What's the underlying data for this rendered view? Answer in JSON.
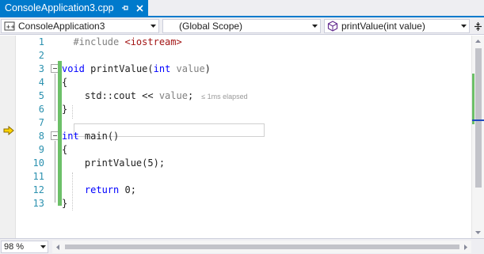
{
  "tab": {
    "title": "ConsoleApplication3.cpp",
    "pin_icon": "pin-icon",
    "close_icon": "close-icon"
  },
  "navbar": {
    "project": "ConsoleApplication3",
    "scope": "(Global Scope)",
    "member": "printValue(int value)",
    "project_icon": "cpp-project-icon",
    "member_icon": "function-icon",
    "split_icon": "split-window-icon"
  },
  "editor": {
    "line_numbers": [
      "1",
      "2",
      "3",
      "4",
      "5",
      "6",
      "7",
      "8",
      "9",
      "10",
      "11",
      "12",
      "13"
    ],
    "lines": {
      "l1_directive": "#include",
      "l1_header": "<iostream>",
      "l3_kw": "void",
      "l3_name": "printValue(",
      "l3_param_kw": "int",
      "l3_param": "value",
      "l3_close": ")",
      "l4": "{",
      "l5_code": "std::cout << ",
      "l5_value": "value",
      "l5_end": ";",
      "l5_perftip": "≤ 1ms elapsed",
      "l6": "}",
      "l8_kw": "int",
      "l8_name": "main()",
      "l9": "{",
      "l10": "printValue(5);",
      "l12_kw": "return",
      "l12_rest": "0;",
      "l13": "}"
    },
    "instruction_pointer_icon": "instruction-pointer-arrow-icon",
    "current_line": 5
  },
  "status": {
    "zoom": "98 %"
  },
  "colors": {
    "accent": "#007acc",
    "keyword": "#0000ff",
    "line_number": "#2b91af",
    "change_bar": "#6cc068",
    "string": "#a31515",
    "comment_gray": "#808080"
  }
}
